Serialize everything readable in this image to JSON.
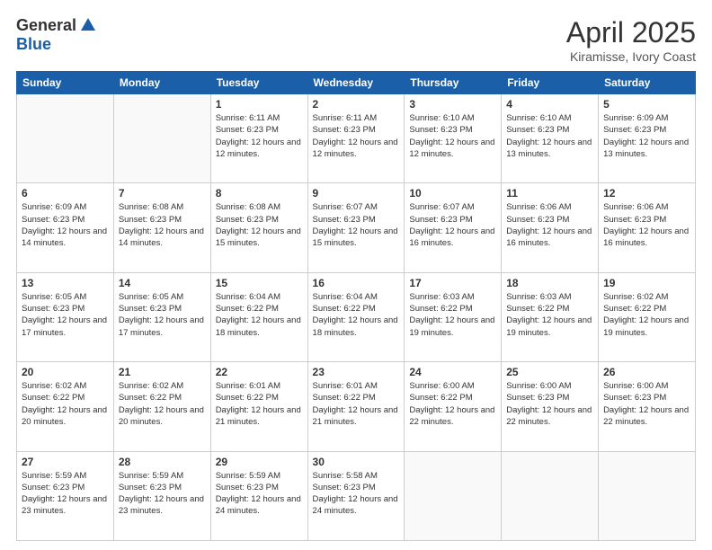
{
  "header": {
    "logo_general": "General",
    "logo_blue": "Blue",
    "month_title": "April 2025",
    "location": "Kiramisse, Ivory Coast"
  },
  "weekdays": [
    "Sunday",
    "Monday",
    "Tuesday",
    "Wednesday",
    "Thursday",
    "Friday",
    "Saturday"
  ],
  "weeks": [
    [
      {
        "day": "",
        "info": ""
      },
      {
        "day": "",
        "info": ""
      },
      {
        "day": "1",
        "info": "Sunrise: 6:11 AM\nSunset: 6:23 PM\nDaylight: 12 hours and 12 minutes."
      },
      {
        "day": "2",
        "info": "Sunrise: 6:11 AM\nSunset: 6:23 PM\nDaylight: 12 hours and 12 minutes."
      },
      {
        "day": "3",
        "info": "Sunrise: 6:10 AM\nSunset: 6:23 PM\nDaylight: 12 hours and 12 minutes."
      },
      {
        "day": "4",
        "info": "Sunrise: 6:10 AM\nSunset: 6:23 PM\nDaylight: 12 hours and 13 minutes."
      },
      {
        "day": "5",
        "info": "Sunrise: 6:09 AM\nSunset: 6:23 PM\nDaylight: 12 hours and 13 minutes."
      }
    ],
    [
      {
        "day": "6",
        "info": "Sunrise: 6:09 AM\nSunset: 6:23 PM\nDaylight: 12 hours and 14 minutes."
      },
      {
        "day": "7",
        "info": "Sunrise: 6:08 AM\nSunset: 6:23 PM\nDaylight: 12 hours and 14 minutes."
      },
      {
        "day": "8",
        "info": "Sunrise: 6:08 AM\nSunset: 6:23 PM\nDaylight: 12 hours and 15 minutes."
      },
      {
        "day": "9",
        "info": "Sunrise: 6:07 AM\nSunset: 6:23 PM\nDaylight: 12 hours and 15 minutes."
      },
      {
        "day": "10",
        "info": "Sunrise: 6:07 AM\nSunset: 6:23 PM\nDaylight: 12 hours and 16 minutes."
      },
      {
        "day": "11",
        "info": "Sunrise: 6:06 AM\nSunset: 6:23 PM\nDaylight: 12 hours and 16 minutes."
      },
      {
        "day": "12",
        "info": "Sunrise: 6:06 AM\nSunset: 6:23 PM\nDaylight: 12 hours and 16 minutes."
      }
    ],
    [
      {
        "day": "13",
        "info": "Sunrise: 6:05 AM\nSunset: 6:23 PM\nDaylight: 12 hours and 17 minutes."
      },
      {
        "day": "14",
        "info": "Sunrise: 6:05 AM\nSunset: 6:23 PM\nDaylight: 12 hours and 17 minutes."
      },
      {
        "day": "15",
        "info": "Sunrise: 6:04 AM\nSunset: 6:22 PM\nDaylight: 12 hours and 18 minutes."
      },
      {
        "day": "16",
        "info": "Sunrise: 6:04 AM\nSunset: 6:22 PM\nDaylight: 12 hours and 18 minutes."
      },
      {
        "day": "17",
        "info": "Sunrise: 6:03 AM\nSunset: 6:22 PM\nDaylight: 12 hours and 19 minutes."
      },
      {
        "day": "18",
        "info": "Sunrise: 6:03 AM\nSunset: 6:22 PM\nDaylight: 12 hours and 19 minutes."
      },
      {
        "day": "19",
        "info": "Sunrise: 6:02 AM\nSunset: 6:22 PM\nDaylight: 12 hours and 19 minutes."
      }
    ],
    [
      {
        "day": "20",
        "info": "Sunrise: 6:02 AM\nSunset: 6:22 PM\nDaylight: 12 hours and 20 minutes."
      },
      {
        "day": "21",
        "info": "Sunrise: 6:02 AM\nSunset: 6:22 PM\nDaylight: 12 hours and 20 minutes."
      },
      {
        "day": "22",
        "info": "Sunrise: 6:01 AM\nSunset: 6:22 PM\nDaylight: 12 hours and 21 minutes."
      },
      {
        "day": "23",
        "info": "Sunrise: 6:01 AM\nSunset: 6:22 PM\nDaylight: 12 hours and 21 minutes."
      },
      {
        "day": "24",
        "info": "Sunrise: 6:00 AM\nSunset: 6:22 PM\nDaylight: 12 hours and 22 minutes."
      },
      {
        "day": "25",
        "info": "Sunrise: 6:00 AM\nSunset: 6:23 PM\nDaylight: 12 hours and 22 minutes."
      },
      {
        "day": "26",
        "info": "Sunrise: 6:00 AM\nSunset: 6:23 PM\nDaylight: 12 hours and 22 minutes."
      }
    ],
    [
      {
        "day": "27",
        "info": "Sunrise: 5:59 AM\nSunset: 6:23 PM\nDaylight: 12 hours and 23 minutes."
      },
      {
        "day": "28",
        "info": "Sunrise: 5:59 AM\nSunset: 6:23 PM\nDaylight: 12 hours and 23 minutes."
      },
      {
        "day": "29",
        "info": "Sunrise: 5:59 AM\nSunset: 6:23 PM\nDaylight: 12 hours and 24 minutes."
      },
      {
        "day": "30",
        "info": "Sunrise: 5:58 AM\nSunset: 6:23 PM\nDaylight: 12 hours and 24 minutes."
      },
      {
        "day": "",
        "info": ""
      },
      {
        "day": "",
        "info": ""
      },
      {
        "day": "",
        "info": ""
      }
    ]
  ]
}
